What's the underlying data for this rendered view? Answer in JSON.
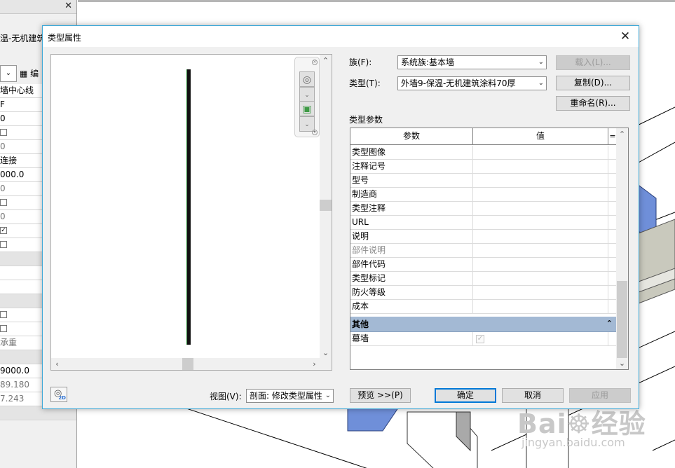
{
  "left_panel": {
    "name_fragment": "温-无机建筑",
    "edit_fragment": "编",
    "rows": [
      {
        "text": "墙中心线",
        "style": "normal"
      },
      {
        "text": "F",
        "style": "normal"
      },
      {
        "text": "0",
        "style": "normal"
      },
      {
        "text": "",
        "style": "checkbox"
      },
      {
        "text": "0",
        "style": "gray"
      },
      {
        "text": "连接",
        "style": "normal"
      },
      {
        "text": "000.0",
        "style": "normal"
      },
      {
        "text": "0",
        "style": "gray"
      },
      {
        "text": "",
        "style": "checkbox"
      },
      {
        "text": "0",
        "style": "gray"
      },
      {
        "text": "",
        "style": "checkbox-on"
      },
      {
        "text": "",
        "style": "checkbox"
      },
      {
        "text": "",
        "style": "header"
      },
      {
        "text": "",
        "style": "normal"
      },
      {
        "text": "",
        "style": "normal"
      },
      {
        "text": "",
        "style": "header"
      },
      {
        "text": "",
        "style": "checkbox"
      },
      {
        "text": "",
        "style": "checkbox"
      },
      {
        "text": "承重",
        "style": "gray"
      },
      {
        "text": "",
        "style": "header"
      },
      {
        "text": "9000.0",
        "style": "normal"
      },
      {
        "text": "89.180",
        "style": "gray"
      },
      {
        "text": "7.243",
        "style": "gray"
      },
      {
        "text": "",
        "style": "header"
      }
    ]
  },
  "dialog": {
    "title": "类型属性",
    "close_symbol": "✕",
    "family_label": "族(F):",
    "family_value": "系统族:基本墙",
    "type_label": "类型(T):",
    "type_value": "外墙9-保温-无机建筑涂料70厚",
    "load_button": "载入(L)...",
    "duplicate_button": "复制(D)...",
    "rename_button": "重命名(R)...",
    "type_params_label": "类型参数",
    "table": {
      "col_param": "参数",
      "col_value": "值",
      "col_eq": "=",
      "rows": [
        {
          "name": "类型图像",
          "gray": false
        },
        {
          "name": "注释记号",
          "gray": false
        },
        {
          "name": "型号",
          "gray": false
        },
        {
          "name": "制造商",
          "gray": false
        },
        {
          "name": "类型注释",
          "gray": false
        },
        {
          "name": "URL",
          "gray": false
        },
        {
          "name": "说明",
          "gray": false
        },
        {
          "name": "部件说明",
          "gray": true
        },
        {
          "name": "部件代码",
          "gray": false
        },
        {
          "name": "类型标记",
          "gray": false
        },
        {
          "name": "防火等级",
          "gray": false
        },
        {
          "name": "成本",
          "gray": false
        }
      ],
      "group": {
        "name": "其他",
        "collapse_symbol": "⌃"
      },
      "group_rows": [
        {
          "name": "幕墙",
          "checked": true
        }
      ]
    },
    "view_label": "视图(V):",
    "view_value": "剖面: 修改类型属性",
    "preview_button": "预览 >>(P)",
    "ok_button": "确定",
    "cancel_button": "取消",
    "apply_button": "应用"
  },
  "watermark": {
    "main": "Bai",
    "main_tail": "经验",
    "sub": "jingyan.baidu.com"
  }
}
